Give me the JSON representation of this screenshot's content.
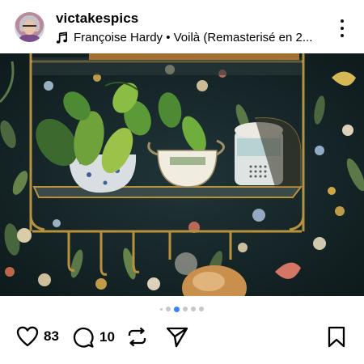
{
  "post": {
    "username": "victakespics",
    "audio": "Françoise Hardy • Voilà (Remasterisé en 2..."
  },
  "icons": {
    "avatar": "profile-avatar",
    "music": "music-note-icon",
    "more": "more-vertical-icon",
    "mute": "speaker-muted-icon",
    "like": "heart-icon",
    "comment": "comment-bubble-icon",
    "repost": "repost-icon",
    "share": "send-icon",
    "save": "bookmark-icon"
  },
  "carousel": {
    "total": 6,
    "active_index": 2
  },
  "actions": {
    "likes": "83",
    "comments": "10"
  },
  "colors": {
    "accent": "#3b82f6",
    "text": "#000000"
  }
}
